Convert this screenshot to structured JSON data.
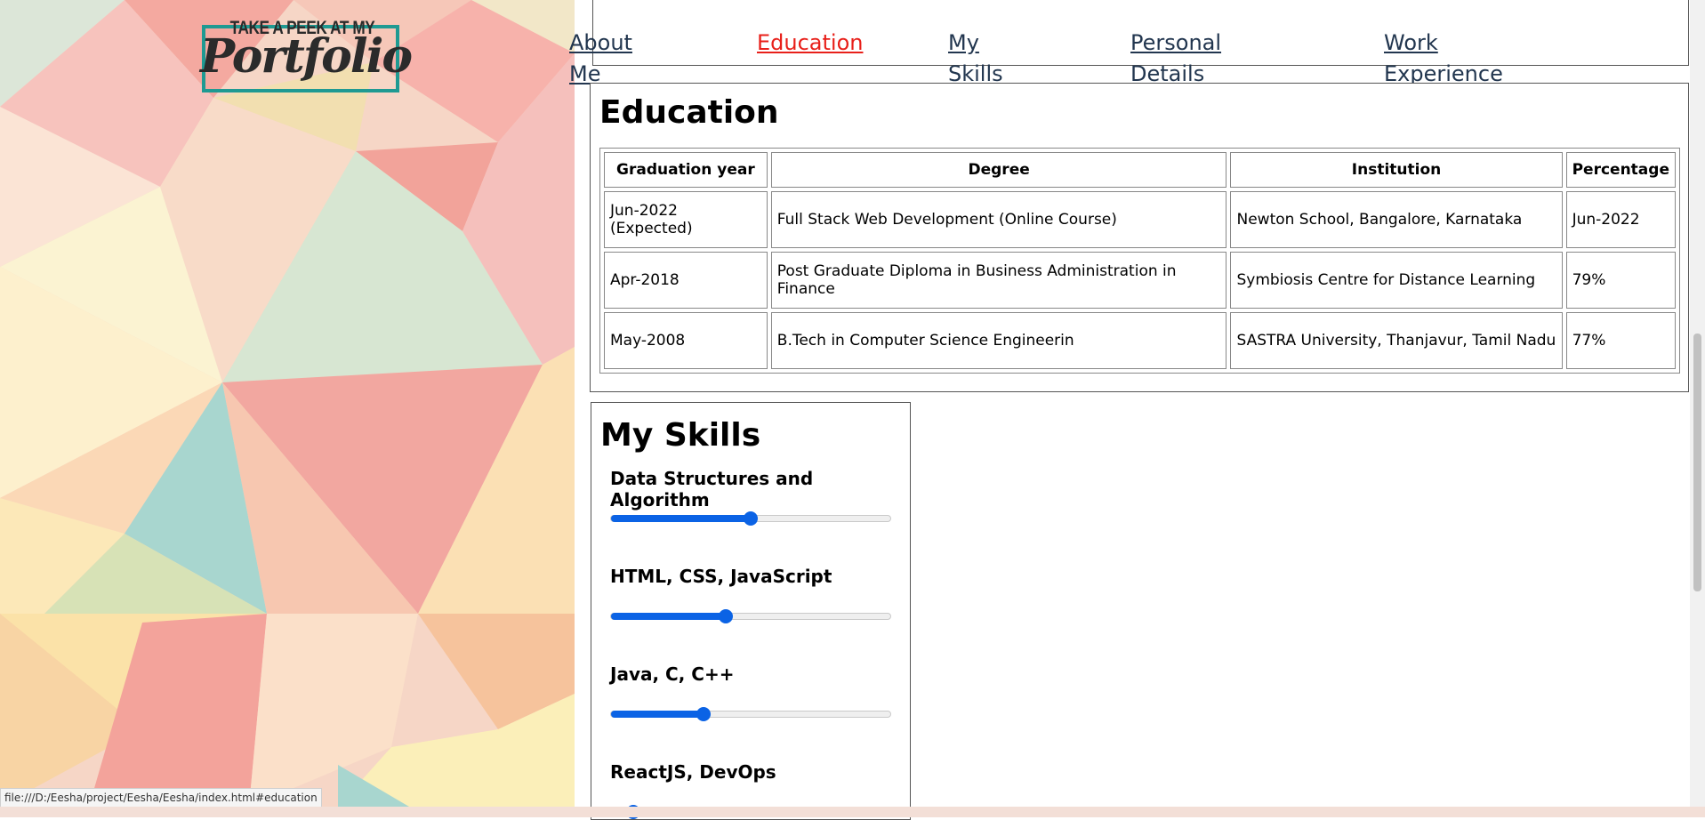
{
  "logo": {
    "tagline": "TAKE A PEEK AT MY",
    "title": "Portfolio"
  },
  "nav": {
    "items": [
      {
        "label": "About Me",
        "active": false
      },
      {
        "label": "Education",
        "active": true
      },
      {
        "label": "My Skills",
        "active": false
      },
      {
        "label": "Personal Details",
        "active": false
      },
      {
        "label": "Work Experience",
        "active": false
      }
    ]
  },
  "education": {
    "title": "Education",
    "columns": [
      "Graduation year",
      "Degree",
      "Institution",
      "Percentage"
    ],
    "rows": [
      [
        "Jun-2022 (Expected)",
        "Full Stack Web Development (Online Course)",
        "Newton School, Bangalore, Karnataka",
        "Jun-2022"
      ],
      [
        "Apr-2018",
        "Post Graduate Diploma in Business Administration in Finance",
        "Symbiosis Centre for Distance Learning",
        "79%"
      ],
      [
        "May-2008",
        "B.Tech in Computer Science Engineerin",
        "SASTRA University, Thanjavur, Tamil Nadu",
        "77%"
      ]
    ]
  },
  "skills": {
    "title": "My Skills",
    "items": [
      {
        "label": "Data Structures and Algorithm",
        "level": 0.5
      },
      {
        "label": "HTML, CSS, JavaScript",
        "level": 0.41
      },
      {
        "label": "Java, C, C++",
        "level": 0.33
      },
      {
        "label": "ReactJS, DevOps",
        "level": 0.08
      }
    ]
  },
  "status_bar": {
    "url": "file:///D:/Eesha/project/Eesha/Eesha/index.html#education"
  },
  "colors": {
    "accent": "#0b63e5",
    "active_link": "#e8201a",
    "link": "#22364f",
    "logo_frame": "#1f9a92"
  }
}
